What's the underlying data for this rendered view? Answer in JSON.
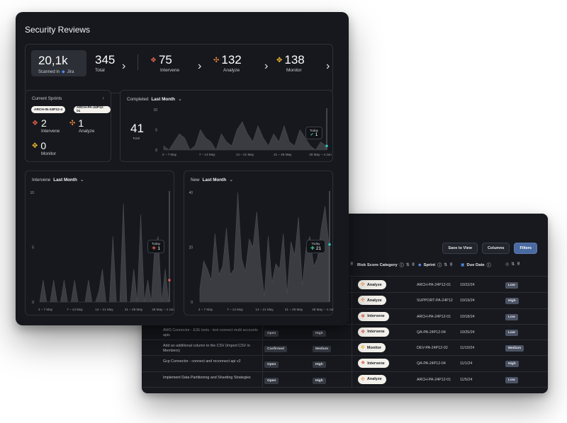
{
  "front": {
    "title": "Security Reviews",
    "scanned": {
      "value": "20,1k",
      "label": "Scanned in",
      "source": "Jira"
    },
    "total": {
      "value": "345",
      "label": "Total"
    },
    "intervene": {
      "value": "75",
      "label": "Intervene"
    },
    "analyze": {
      "value": "132",
      "label": "Analyze"
    },
    "monitor": {
      "value": "138",
      "label": "Monitor"
    },
    "sprints": {
      "title": "Current Sprints",
      "tags": [
        "ARCH-IN-24P12-4",
        "ARCH-PA-24P12-01"
      ],
      "intervene": {
        "value": "2",
        "label": "Intervene"
      },
      "analyze": {
        "value": "1",
        "label": "Analyze"
      },
      "monitor": {
        "value": "0",
        "label": "Monitor"
      }
    },
    "completed": {
      "title": "Completed",
      "period": "Last Month",
      "total": "41",
      "total_label": "Total",
      "tooltip": {
        "label": "Today",
        "value": "1"
      }
    },
    "intervene_chart": {
      "title": "Intervene",
      "period": "Last Month",
      "tooltip": {
        "label": "Today",
        "value": "1"
      }
    },
    "new_chart": {
      "title": "New",
      "period": "Last Month",
      "tooltip": {
        "label": "Today",
        "value": "21"
      }
    }
  },
  "chart_data": [
    {
      "type": "area",
      "title": "Completed",
      "categories": [
        "2 – 7 May",
        "7 – 14 May",
        "14 – 21 May",
        "21 – 28 May",
        "28 May – 4 Jun"
      ],
      "yticks": [
        "0",
        "5",
        "10"
      ],
      "ylim": [
        0,
        10
      ],
      "values": [
        1,
        0,
        2,
        4,
        3,
        0,
        1,
        5,
        3,
        2,
        0,
        4,
        2,
        1,
        5,
        7,
        4,
        2,
        6,
        3,
        1,
        4,
        2,
        6,
        2,
        1,
        5,
        3,
        1,
        0,
        2,
        1
      ]
    },
    {
      "type": "area",
      "title": "Intervene",
      "categories": [
        "4 – 7 May",
        "7 – 14 May",
        "14 – 21 May",
        "21 – 28 May",
        "28 May – 4 Jun"
      ],
      "yticks": [
        "0",
        "5",
        "10"
      ],
      "ylim": [
        0,
        10
      ],
      "values": [
        0,
        2,
        0,
        0,
        2,
        0,
        0,
        2,
        0,
        0,
        2,
        0,
        0,
        0,
        2,
        0,
        0,
        1,
        3,
        0,
        0,
        6,
        0,
        0,
        9,
        0,
        0,
        3,
        0,
        8,
        0,
        2,
        0,
        5,
        6,
        0,
        3,
        0
      ]
    },
    {
      "type": "area",
      "title": "New",
      "categories": [
        "4 – 7 May",
        "7 – 14 May",
        "14 – 21 May",
        "21 – 28 May",
        "28 May – 4 Jun"
      ],
      "yticks": [
        "0",
        "20",
        "40"
      ],
      "ylim": [
        0,
        40
      ],
      "values": [
        5,
        15,
        12,
        8,
        25,
        10,
        13,
        27,
        10,
        12,
        40,
        16,
        11,
        23,
        20,
        33,
        14,
        2,
        24,
        7,
        14,
        12,
        25,
        3,
        22,
        17,
        31,
        6,
        20,
        24,
        13,
        16,
        27,
        35,
        21
      ]
    }
  ],
  "table": {
    "toolbar": {
      "save": "Save to View",
      "columns": "Columns",
      "filters": "Filters"
    },
    "headers": {
      "risk": "Risk Score Category",
      "sprint": "Sprint",
      "due": "Due Date"
    },
    "rows": [
      {
        "task": "",
        "status": "",
        "severity": "",
        "risk": "Analyze",
        "risk_icon": "analyze",
        "sprint": "ARCH-PA-24P12-01",
        "due": "10/22/24",
        "priority": "Low"
      },
      {
        "task": "",
        "status": "",
        "severity": "",
        "risk": "Analyze",
        "risk_icon": "analyze",
        "sprint": "SUPPORT-PA-24P12",
        "due": "10/19/24",
        "priority": "High"
      },
      {
        "task": "",
        "status": "",
        "severity": "",
        "risk": "Intervene",
        "risk_icon": "intervene",
        "sprint": "ARCH-PA-24P12-01",
        "due": "10/18/24",
        "priority": "Low"
      },
      {
        "task": "AWS Connector - E2E tests - test connect multi accounts apis",
        "status": "Open",
        "severity": "High",
        "risk": "Intervene",
        "risk_icon": "intervene",
        "sprint": "QA-PA-24P12-04",
        "due": "10/25/24",
        "priority": "Low"
      },
      {
        "task": "Add an additional column to the CSV (Import CSV in Members)",
        "status": "Confirmed",
        "severity": "Medium",
        "risk": "Monitor",
        "risk_icon": "monitor",
        "sprint": "DEV-PA-24P12-02",
        "due": "11/10/24",
        "priority": "Medium"
      },
      {
        "task": "Gcp Connector - connect and reconnect api v2",
        "status": "Open",
        "severity": "High",
        "risk": "Intervene",
        "risk_icon": "intervene",
        "sprint": "QA-PA-24P12-04",
        "due": "11/1/24",
        "priority": "High"
      },
      {
        "task": "Implement Data Partitioning and Sharding Strategies",
        "status": "Open",
        "severity": "High",
        "risk": "Analyze",
        "risk_icon": "analyze",
        "sprint": "ARCH-PA-24P12-01",
        "due": "11/5/24",
        "priority": "Low"
      }
    ]
  },
  "icons": {
    "intervene": "diamond-red-icon",
    "analyze": "arrows-orange-icon",
    "monitor": "cross-yellow-icon",
    "jira": "jira-icon"
  },
  "colors": {
    "intervene": "#e0604a",
    "analyze": "#f08a3c",
    "monitor": "#f2b82e",
    "accent": "#4c8ef7"
  }
}
